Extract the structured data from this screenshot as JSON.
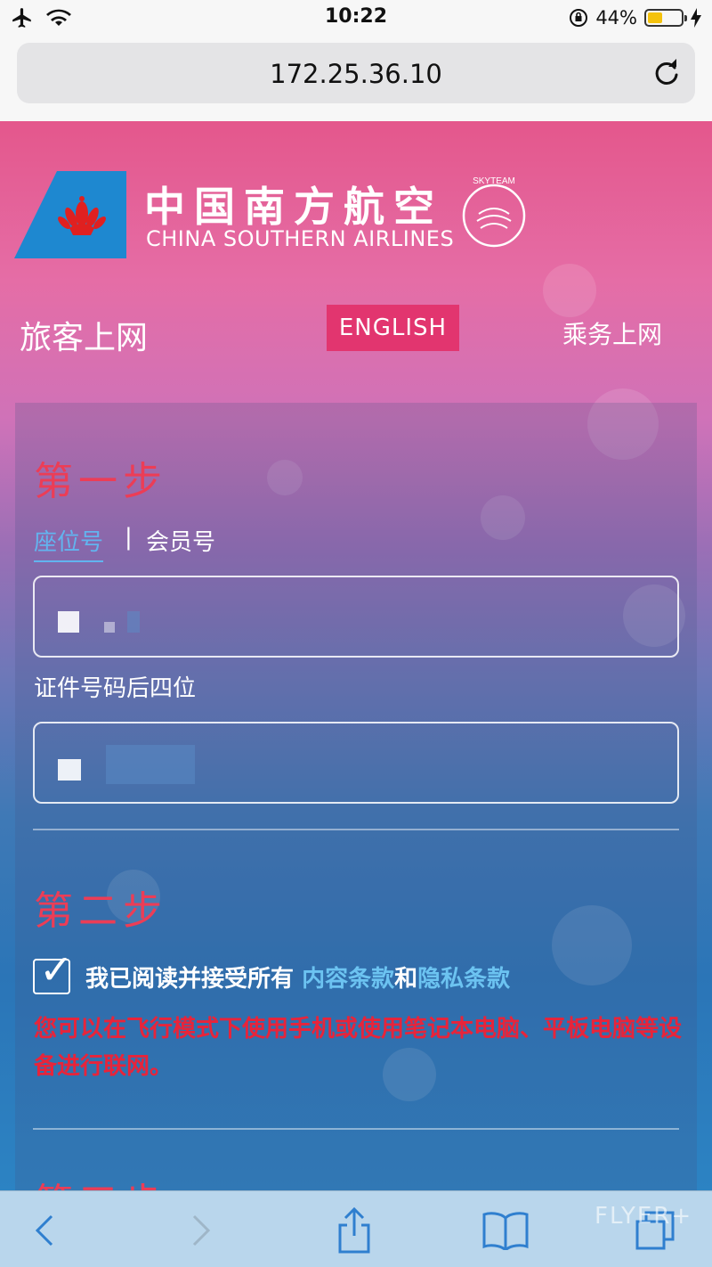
{
  "status_bar": {
    "time": "10:22",
    "battery_percent": "44%",
    "battery_level": 0.44
  },
  "browser": {
    "url": "172.25.36.10"
  },
  "brand": {
    "name_cn": "中国南方航空",
    "name_en": "CHINA SOUTHERN AIRLINES",
    "alliance": "SKYTEAM",
    "colors": {
      "primary_blue": "#1e88d0",
      "red": "#e02020"
    }
  },
  "nav": {
    "passenger": "旅客上网",
    "english": "ENGLISH",
    "crew": "乘务上网"
  },
  "step1": {
    "title": "第一步",
    "tab_seat": "座位号",
    "separator": "|",
    "tab_member": "会员号",
    "id_label": "证件号码后四位"
  },
  "step2": {
    "title": "第二步",
    "agree_text": "我已阅读并接受所有 ",
    "terms_link": "内容条款",
    "and": "和",
    "privacy_link": "隐私条款",
    "notice": "您可以在飞行模式下使用手机或使用笔记本电脑、平板电脑等设备进行联网。",
    "checked": true
  },
  "step3": {
    "title": "第三步"
  },
  "toolbar": {
    "watermark": "FLYER+"
  }
}
